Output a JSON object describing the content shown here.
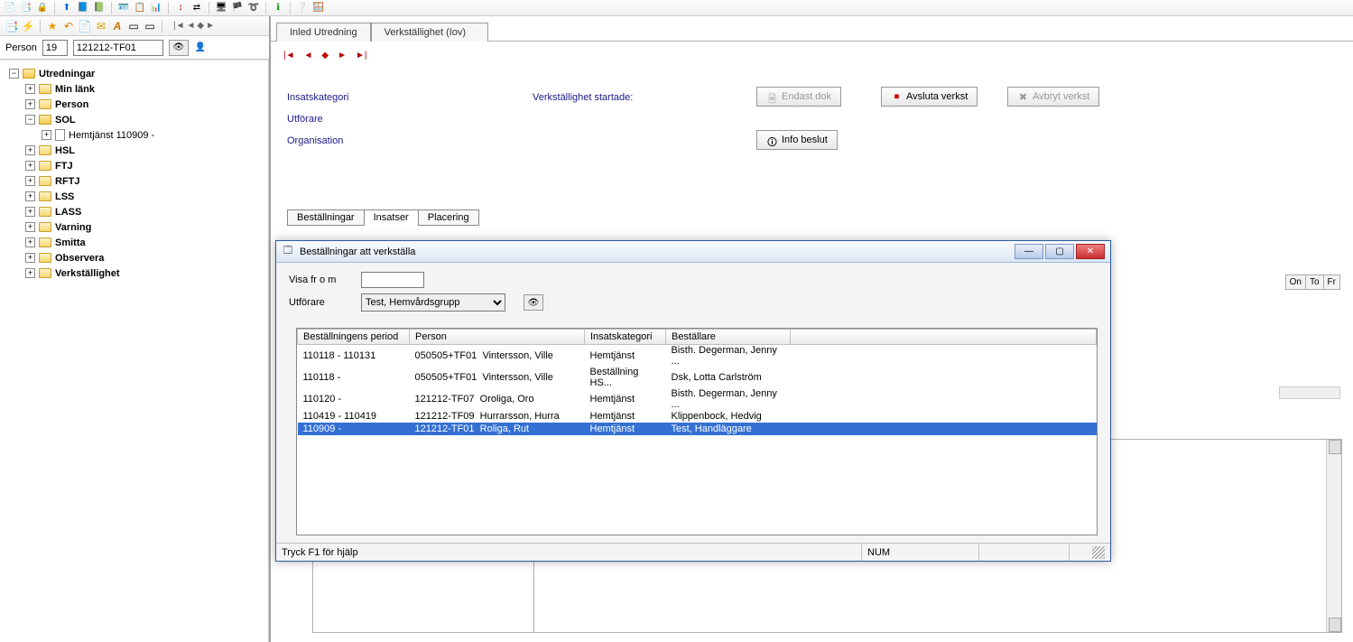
{
  "left": {
    "person_label": "Person",
    "person_age": "19",
    "person_id": "121212-TF01",
    "tree": {
      "root": "Utredningar",
      "nodes": [
        {
          "label": "Min länk",
          "bold": true
        },
        {
          "label": "Person",
          "bold": true
        },
        {
          "label": "SOL",
          "bold": true
        },
        {
          "label": "Hemtjänst 110909 -",
          "bold": false,
          "level": 2,
          "doc": true
        },
        {
          "label": "HSL",
          "bold": true
        },
        {
          "label": "FTJ",
          "bold": true
        },
        {
          "label": "RFTJ",
          "bold": true
        },
        {
          "label": "LSS",
          "bold": true
        },
        {
          "label": "LASS",
          "bold": true
        },
        {
          "label": "Varning",
          "bold": true
        },
        {
          "label": "Smitta",
          "bold": true
        },
        {
          "label": "Observera",
          "bold": true
        },
        {
          "label": "Verkställighet",
          "bold": true
        }
      ]
    }
  },
  "tabs": {
    "t1": "Inled Utredning",
    "t2": "Verkställighet (Iov)"
  },
  "info": {
    "insatskategori": "Insatskategori",
    "utforare": "Utförare",
    "organisation": "Organisation",
    "verkstartade": "Verkställighet startade:"
  },
  "buttons": {
    "endast_dok": "Endast dok",
    "avsluta": "Avsluta verkst",
    "avbryt": "Avbryt verkst",
    "info_beslut": "Info beslut"
  },
  "sub_tabs": {
    "t1": "Beställningar",
    "t2": "Insatser",
    "t3": "Placering"
  },
  "wk": [
    "On",
    "To",
    "Fr"
  ],
  "dialog": {
    "title": "Beställningar att verkställa",
    "visa_label": "Visa fr o m",
    "utforare_label": "Utförare",
    "utforare_value": "Test, Hemvårdsgrupp",
    "cols": {
      "c1": "Beställningens period",
      "c2": "Person",
      "c3": "Insatskategori",
      "c4": "Beställare"
    },
    "rows": [
      {
        "period": "110118 - 110131",
        "pid": "050505+TF01",
        "pname": "Vintersson, Ville",
        "kat": "Hemtjänst",
        "best": "Bisth. Degerman, Jenny ..."
      },
      {
        "period": "110118 -",
        "pid": "050505+TF01",
        "pname": "Vintersson, Ville",
        "kat": "Beställning HS...",
        "best": "Dsk, Lotta Carlström"
      },
      {
        "period": "110120 -",
        "pid": "121212-TF07",
        "pname": "Oroliga, Oro",
        "kat": "Hemtjänst",
        "best": "Bisth. Degerman, Jenny ..."
      },
      {
        "period": "110419 - 110419",
        "pid": "121212-TF09",
        "pname": "Hurrarsson, Hurra",
        "kat": "Hemtjänst",
        "best": "Klippenbock, Hedvig"
      },
      {
        "period": "110909 -",
        "pid": "121212-TF01",
        "pname": "Roliga, Rut",
        "kat": "Hemtjänst",
        "best": "Test, Handläggare"
      }
    ],
    "status_help": "Tryck F1 för hjälp",
    "status_num": "NUM"
  }
}
